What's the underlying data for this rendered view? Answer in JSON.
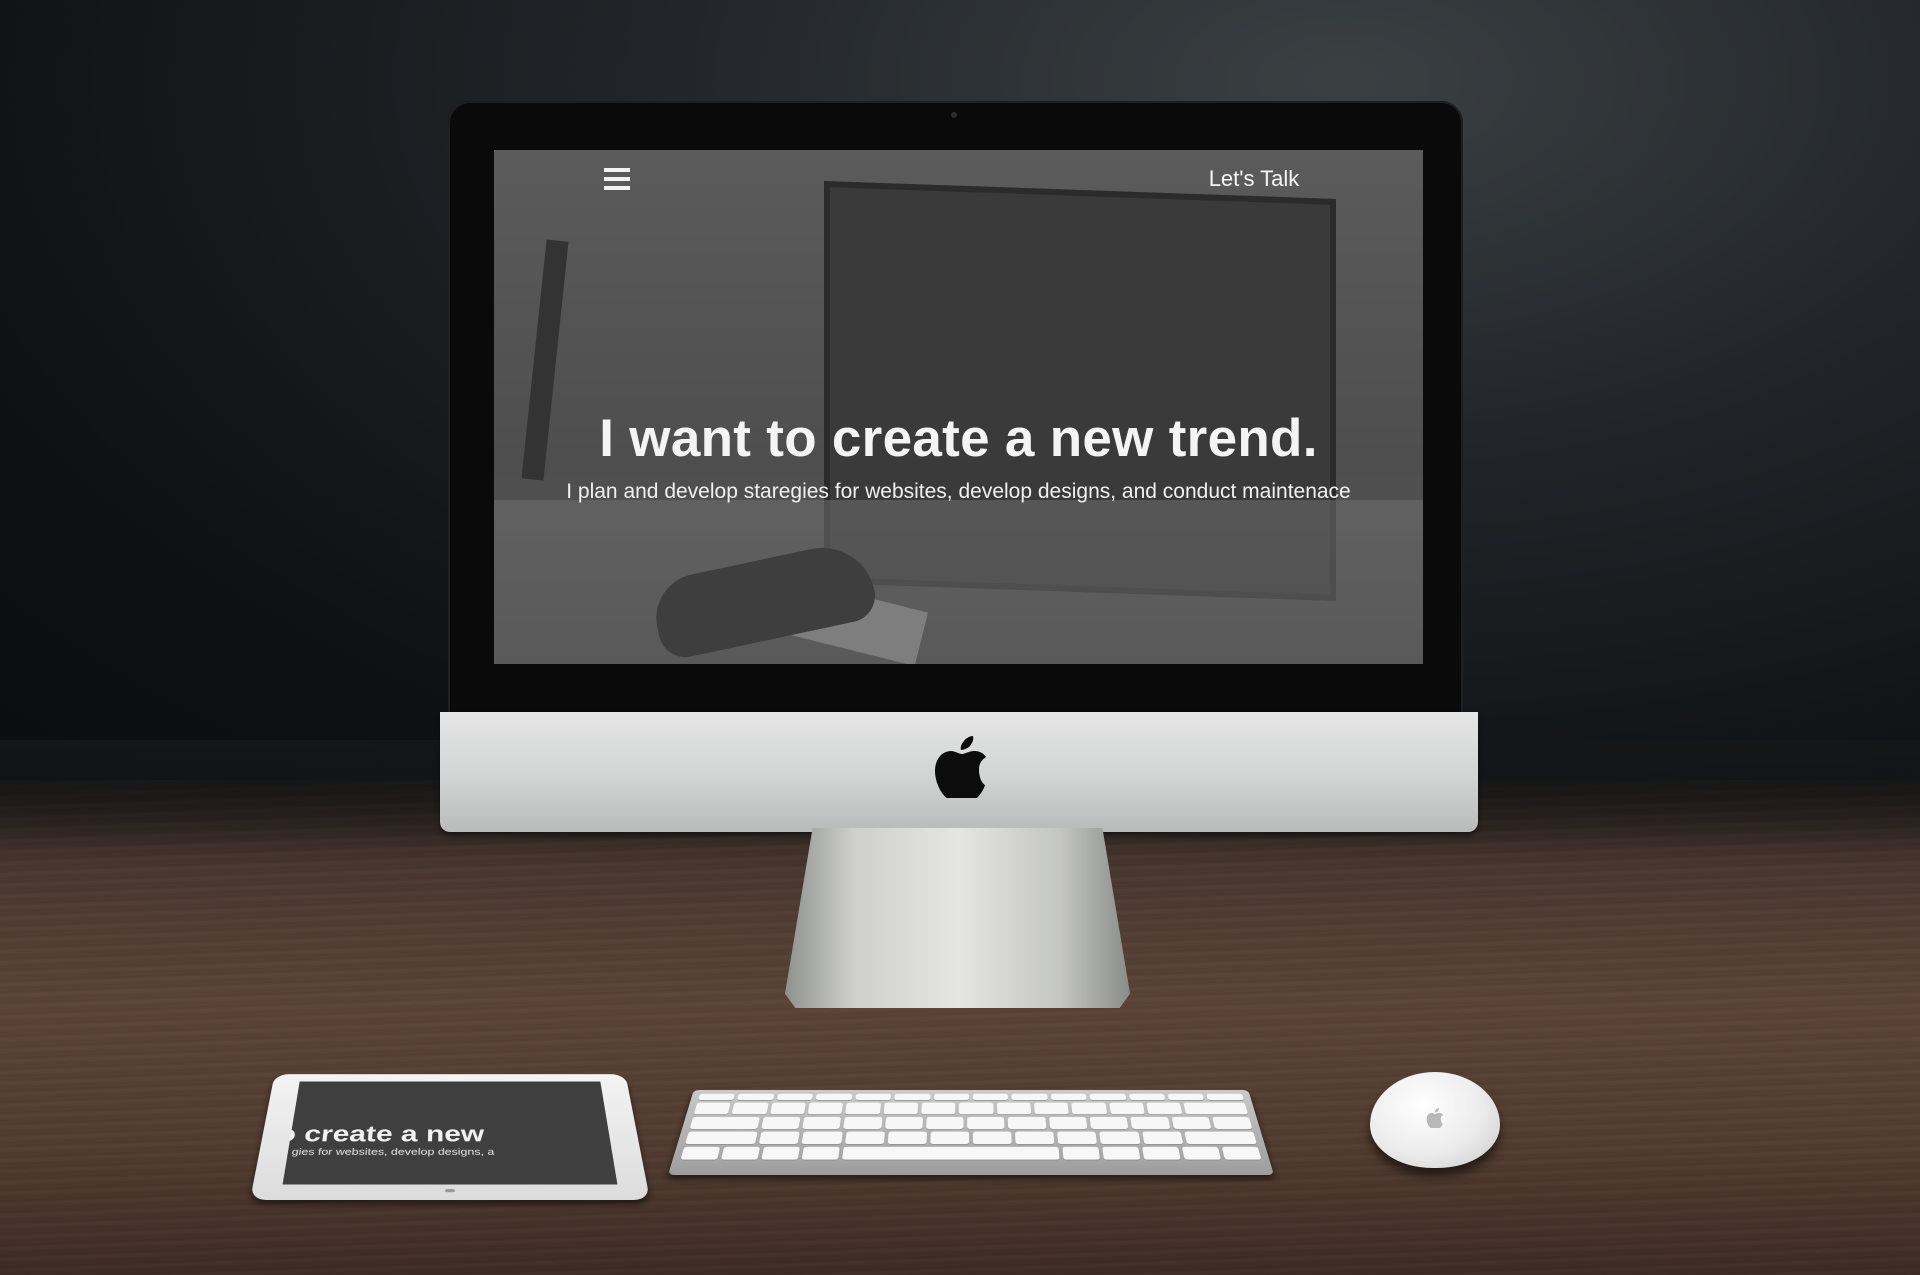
{
  "website": {
    "nav": {
      "menu_icon": "hamburger-menu-icon",
      "cta_label": "Let's Talk"
    },
    "hero": {
      "title": "I want to create a new trend.",
      "subtitle": "I plan and develop staregies for websites, develop designs, and conduct maintenace"
    }
  },
  "tablet": {
    "title_fragment": "o create a new",
    "subtitle_fragment": "gies for websites, develop designs, a"
  },
  "devices": {
    "monitor_logo": "apple-logo",
    "mouse_logo": "apple-logo"
  },
  "colors": {
    "screen_overlay": "#4e4e4e",
    "hero_text": "#f4f4f4",
    "desk_wood": "#5c4437",
    "background": "#0f1113"
  }
}
